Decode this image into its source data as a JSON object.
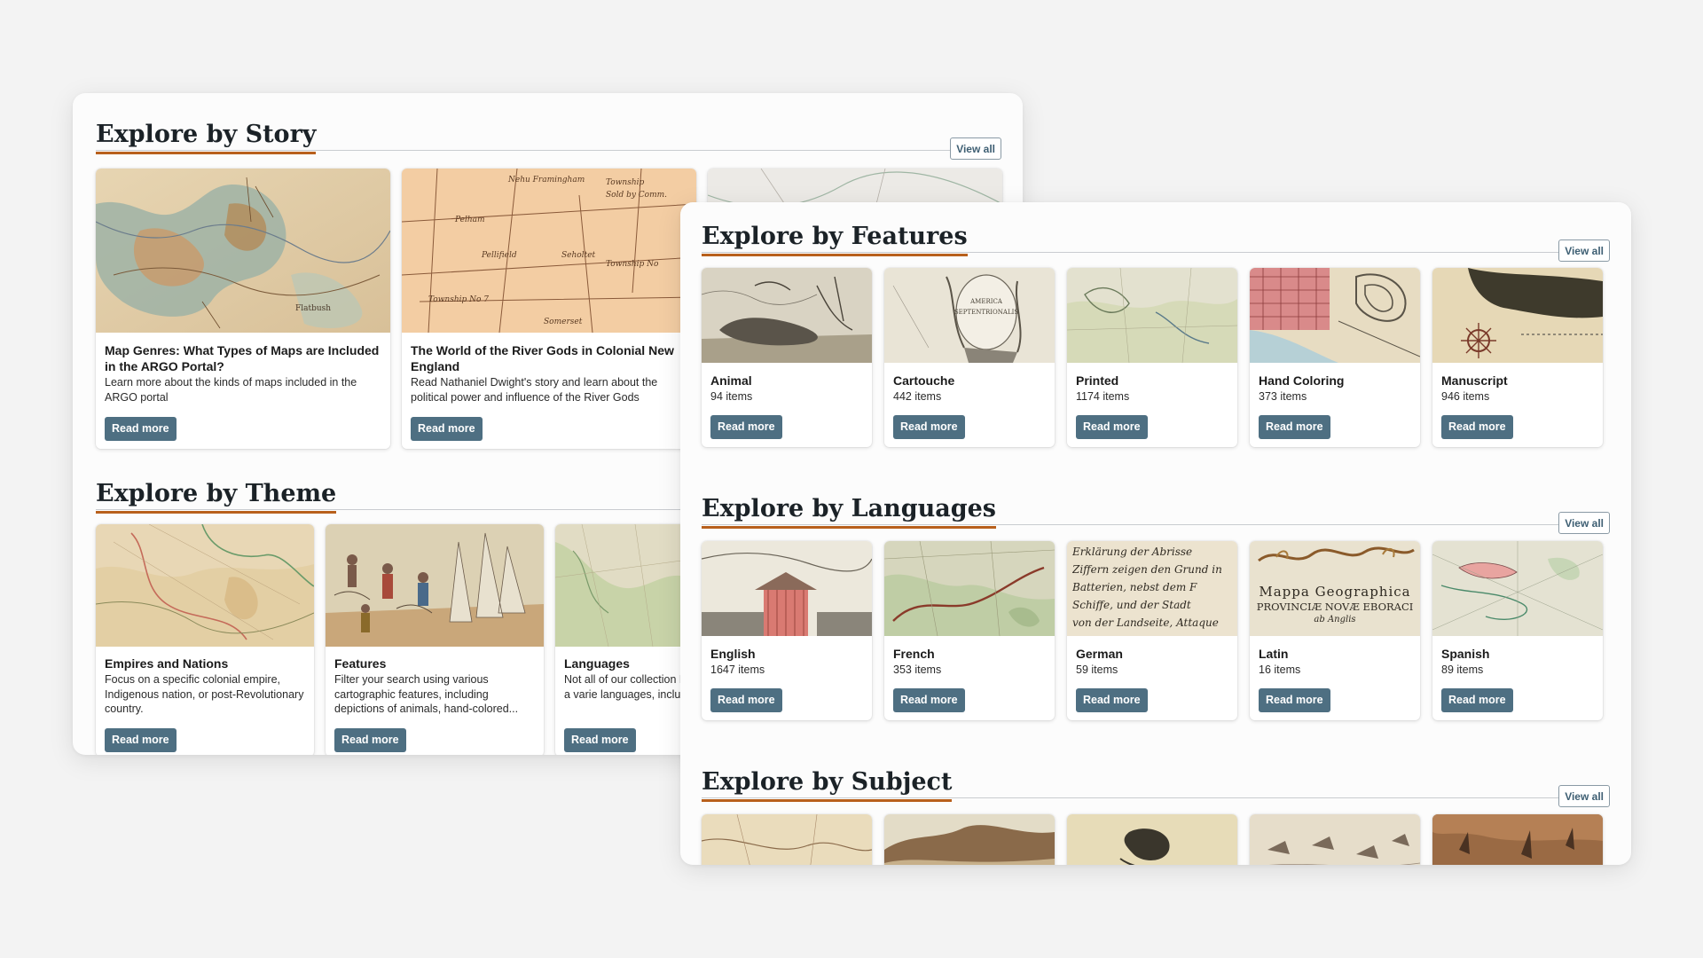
{
  "story": {
    "title": "Explore by Story",
    "view_all": "View all",
    "cards": [
      {
        "title": "Map Genres: What Types of Maps are Included in the ARGO Portal?",
        "desc": "Learn more about the kinds of maps included in the ARGO portal",
        "button": "Read more"
      },
      {
        "title": "The World of the River Gods in Colonial New England",
        "desc": "Read Nathaniel Dwight's story and learn about the political power and influence of the River Gods",
        "button": "Read more"
      }
    ]
  },
  "theme": {
    "title": "Explore by Theme",
    "cards": [
      {
        "title": "Empires and Nations",
        "desc": "Focus on a specific colonial empire, Indigenous nation, or post-Revolutionary country.",
        "button": "Read more"
      },
      {
        "title": "Features",
        "desc": "Filter your search using various cartographic features, including depictions of animals, hand-colored...",
        "button": "Read more"
      },
      {
        "title": "Languages",
        "desc": "Not all of our collection Browse maps in a varie languages, including La",
        "button": "Read more"
      }
    ]
  },
  "features": {
    "title": "Explore by Features",
    "view_all": "View all",
    "cards": [
      {
        "title": "Animal",
        "count": "94 items",
        "button": "Read more"
      },
      {
        "title": "Cartouche",
        "count": "442 items",
        "button": "Read more"
      },
      {
        "title": "Printed",
        "count": "1174 items",
        "button": "Read more"
      },
      {
        "title": "Hand Coloring",
        "count": "373 items",
        "button": "Read more"
      },
      {
        "title": "Manuscript",
        "count": "946 items",
        "button": "Read more"
      }
    ]
  },
  "languages": {
    "title": "Explore by Languages",
    "view_all": "View all",
    "cards": [
      {
        "title": "English",
        "count": "1647 items",
        "button": "Read more"
      },
      {
        "title": "French",
        "count": "353 items",
        "button": "Read more"
      },
      {
        "title": "German",
        "count": "59 items",
        "button": "Read more"
      },
      {
        "title": "Latin",
        "count": "16 items",
        "button": "Read more"
      },
      {
        "title": "Spanish",
        "count": "89 items",
        "button": "Read more"
      }
    ]
  },
  "subject": {
    "title": "Explore by Subject",
    "view_all": "View all"
  },
  "thumb_text": {
    "german_lines": [
      "Erklärung der Abrisse",
      "Ziffern zeigen den Grund in",
      "Batterien, nebst dem F",
      "Schiffe, und der Stadt",
      "von der Landseite, Attaque"
    ],
    "latin_lines": [
      "Mappa Geographica",
      "PROVINCIÆ NOVÆ EBORACI",
      "ab Anglis"
    ]
  },
  "colors": {
    "accent_underline": "#b8601c",
    "button_bg": "#4e6f82",
    "view_all_text": "#3e5f73"
  }
}
